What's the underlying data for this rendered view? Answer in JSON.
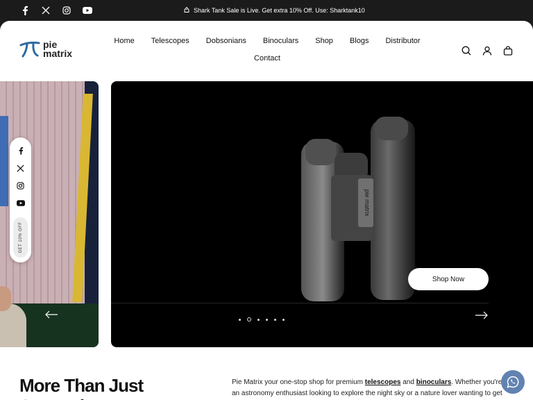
{
  "topbar": {
    "announcement": "Shark Tank Sale is Live. Get extra 10% Off. Use: Sharktank10",
    "social": [
      "facebook-icon",
      "x-icon",
      "instagram-icon",
      "youtube-icon"
    ]
  },
  "logo": {
    "line1": "pie",
    "line2": "matrix"
  },
  "nav": {
    "items": [
      "Home",
      "Telescopes",
      "Dobsonians",
      "Binoculars",
      "Shop",
      "Blogs",
      "Distributor",
      "Contact"
    ]
  },
  "header_icons": [
    "search-icon",
    "account-icon",
    "cart-icon"
  ],
  "floating_social": {
    "offer_label": "GET 10% OFF"
  },
  "hero": {
    "button_label": "Shop Now",
    "product_brand": "pie matrix",
    "slide_count": 6,
    "active_slide": 2
  },
  "intro": {
    "title": "More Than Just Stargazing",
    "text_1": "Pie Matrix your one-stop shop for premium ",
    "link_1": "telescopes",
    "text_2": " and ",
    "link_2": "binoculars",
    "text_3": ". Whether you're an astronomy enthusiast looking to explore the night sky or a nature lover wanting to get up"
  },
  "colors": {
    "topbar": "#1b1b1b",
    "whatsapp": "#6283b1",
    "logo_mark": "#2f6aa3"
  }
}
